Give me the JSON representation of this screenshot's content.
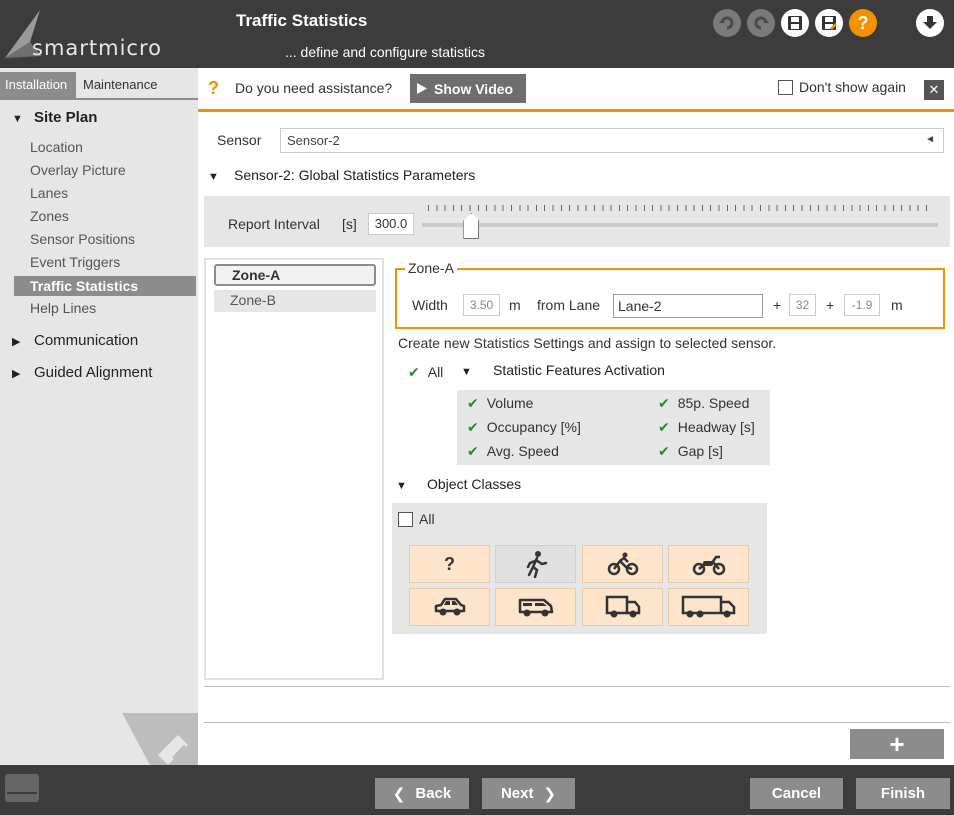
{
  "header": {
    "brand": "smartmicro",
    "title": "Traffic Statistics",
    "subtitle": "... define and configure statistics",
    "help_label": "?",
    "icons": [
      "undo-icon",
      "redo-icon",
      "save-icon",
      "save-as-icon",
      "help-icon",
      "download-icon"
    ]
  },
  "sidebar": {
    "tabs": [
      "Installation",
      "Maintenance"
    ],
    "groups": {
      "site_plan": "Site Plan",
      "communication": "Communication",
      "guided_alignment": "Guided Alignment"
    },
    "items": [
      "Location",
      "Overlay Picture",
      "Lanes",
      "Zones",
      "Sensor Positions",
      "Event Triggers",
      "Traffic Statistics",
      "Help Lines"
    ],
    "tri_open": "▼",
    "tri_closed": "▶"
  },
  "assist": {
    "question_mark": "?",
    "text": "Do you need assistance?",
    "show_video": "Show Video",
    "dont_show": "Don't show again",
    "close": "✕"
  },
  "sensor": {
    "label": "Sensor",
    "value": "Sensor-2",
    "arrow": "◄"
  },
  "global_params": {
    "title": "Sensor-2: Global Statistics Parameters",
    "report_label": "Report Interval",
    "report_unit": "[s]",
    "report_value": "300.0",
    "slider_fraction": 0.08
  },
  "zones": [
    "Zone-A",
    "Zone-B"
  ],
  "zone_box": {
    "title": "Zone-A",
    "width_label": "Width",
    "width_value": "3.50",
    "unit_m": "m",
    "from_lane_label": "from Lane",
    "lane_value": "Lane-2",
    "plus": "+",
    "offset1": "32",
    "offset2": "-1.9"
  },
  "create_text": "Create new Statistics Settings and assign to selected sensor.",
  "features": {
    "all_label": "All",
    "check": "✔",
    "title": "Statistic Features Activation",
    "items": [
      "Volume",
      "Occupancy [%]",
      "Avg. Speed",
      "85p. Speed",
      "Headway [s]",
      "Gap [s]"
    ]
  },
  "object_classes": {
    "title": "Object Classes",
    "all_label": "All",
    "unknown_label": "?",
    "icons": [
      "unknown-icon",
      "pedestrian-icon",
      "bicycle-icon",
      "motorcycle-icon",
      "car-icon",
      "van-icon",
      "truck-icon",
      "large-truck-icon"
    ]
  },
  "add_label": "+",
  "footer": {
    "back": "Back",
    "next": "Next",
    "cancel": "Cancel",
    "finish": "Finish",
    "back_arrow": "❮",
    "next_arrow": "❯"
  },
  "colors": {
    "accent": "#f39200",
    "header_bg": "#3c3c3c",
    "sidebar_bg": "#e6e6e6",
    "selected": "#8c8c8c",
    "check_green": "#2a8a2a"
  }
}
